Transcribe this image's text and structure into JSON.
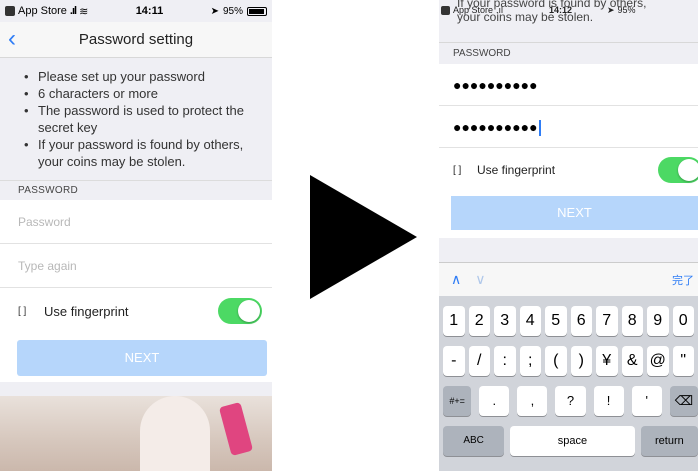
{
  "left": {
    "status": {
      "carrier": "App Store",
      "time": "14:11",
      "battery": "95%"
    },
    "title": "Password setting",
    "notes": [
      "Please set up your password",
      "6 characters or more",
      "The password is used to protect the secret key",
      "If your password is found by others, your coins may be stolen."
    ],
    "section_label": "PASSWORD",
    "password_placeholder": "Password",
    "confirm_placeholder": "Type again",
    "fingerprint_label": "Use fingerprint",
    "fingerprint_on": true,
    "next_label": "NEXT"
  },
  "right": {
    "status": {
      "carrier": "App Store",
      "time": "14:12",
      "battery": "95%"
    },
    "scrolled_text_line1": "If your password is found by others,",
    "scrolled_text_line2": "your coins may be stolen.",
    "section_label": "PASSWORD",
    "password_value": "●●●●●●●●●●",
    "confirm_value": "●●●●●●●●●●",
    "fingerprint_label": "Use fingerprint",
    "fingerprint_on": true,
    "next_label": "NEXT",
    "keyboard": {
      "done_label": "完了",
      "row1": [
        "1",
        "2",
        "3",
        "4",
        "5",
        "6",
        "7",
        "8",
        "9",
        "0"
      ],
      "row2": [
        "-",
        "/",
        ":",
        ";",
        "(",
        ")",
        "¥",
        "&",
        "@",
        "\""
      ],
      "row3": [
        "#+=",
        ".",
        ",",
        "?",
        "!",
        "'",
        "⌫"
      ],
      "row4": [
        "ABC",
        "space",
        "return"
      ]
    }
  }
}
